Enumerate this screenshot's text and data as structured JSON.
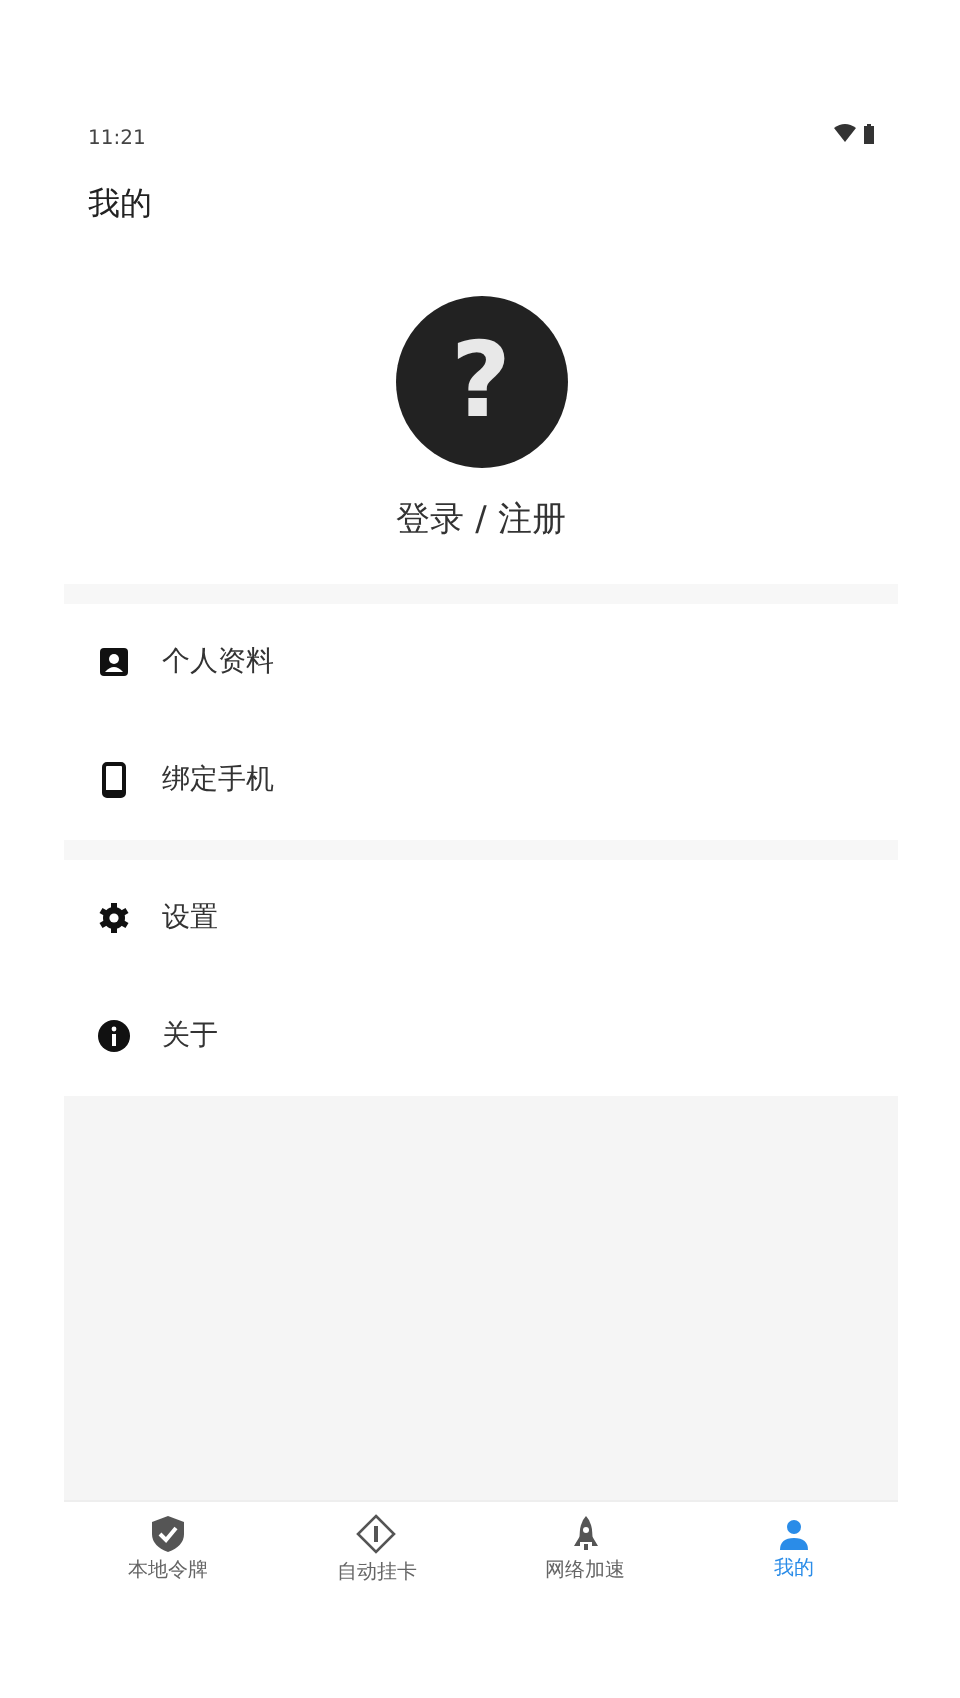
{
  "status_bar": {
    "time": "11:21"
  },
  "header": {
    "title": "我的"
  },
  "profile": {
    "avatar_glyph": "?",
    "login_label": "登录 / 注册"
  },
  "menu_groups": [
    {
      "items": [
        {
          "kind": "profile",
          "label": "个人资料"
        },
        {
          "kind": "phone",
          "label": "绑定手机"
        }
      ]
    },
    {
      "items": [
        {
          "kind": "settings",
          "label": "设置"
        },
        {
          "kind": "info",
          "label": "关于"
        }
      ]
    }
  ],
  "tabs": [
    {
      "kind": "shield",
      "label": "本地令牌",
      "selected": false
    },
    {
      "kind": "diamond",
      "label": "自动挂卡",
      "selected": false
    },
    {
      "kind": "rocket",
      "label": "网络加速",
      "selected": false
    },
    {
      "kind": "person",
      "label": "我的",
      "selected": true
    }
  ]
}
